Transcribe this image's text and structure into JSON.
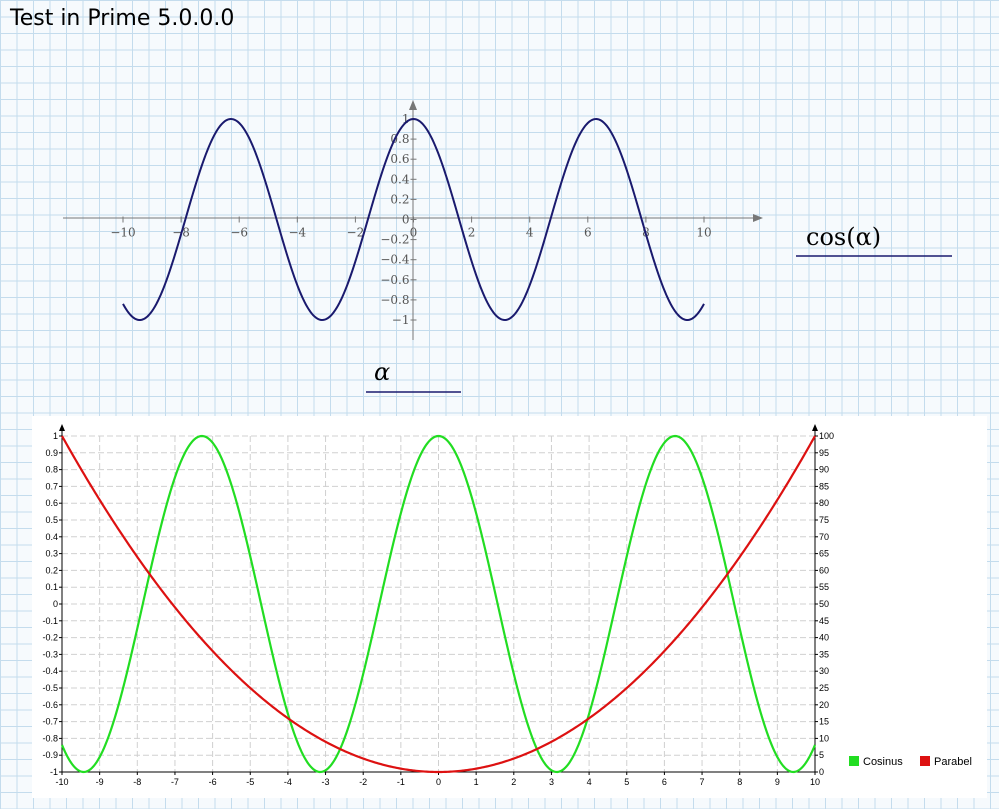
{
  "page": {
    "title": "Test in Prime 5.0.0.0"
  },
  "colors": {
    "cos_top": "#1a1a6e",
    "cosinus": "#22dd22",
    "parabel": "#dd1111",
    "axis": "#777777"
  },
  "chart_data": [
    {
      "type": "line",
      "function": "cos(α)",
      "ylabel": "cos(α)",
      "xlabel": "α",
      "xlim": [
        -10,
        10
      ],
      "ylim": [
        -1,
        1
      ],
      "x_ticks": [
        "−10",
        "−8",
        "−6",
        "−4",
        "−2",
        "0",
        "2",
        "4",
        "6",
        "8",
        "10"
      ],
      "y_ticks": [
        "1",
        "0.8",
        "0.6",
        "0.4",
        "0.2",
        "0",
        "−0.2",
        "−0.4",
        "−0.6",
        "−0.8",
        "−1"
      ],
      "x_tick_values": [
        -10,
        -8,
        -6,
        -4,
        -2,
        0,
        2,
        4,
        6,
        8,
        10
      ],
      "y_tick_values": [
        1,
        0.8,
        0.6,
        0.4,
        0.2,
        0,
        -0.2,
        -0.4,
        -0.6,
        -0.8,
        -1
      ],
      "grid": false
    },
    {
      "type": "line",
      "xlim": [
        -10,
        10
      ],
      "ylim_left": [
        -1,
        1
      ],
      "ylim_right": [
        0,
        100
      ],
      "grid": true,
      "legend_position": "bottom-right",
      "x_ticks": [
        "-10",
        "-9",
        "-8",
        "-7",
        "-6",
        "-5",
        "-4",
        "-3",
        "-2",
        "-1",
        "0",
        "1",
        "2",
        "3",
        "4",
        "5",
        "6",
        "7",
        "8",
        "9",
        "10"
      ],
      "y_left_ticks": [
        "1",
        "0.9",
        "0.8",
        "0.7",
        "0.6",
        "0.5",
        "0.4",
        "0.3",
        "0.2",
        "0.1",
        "0",
        "-0.1",
        "-0.2",
        "-0.3",
        "-0.4",
        "-0.5",
        "-0.6",
        "-0.7",
        "-0.8",
        "-0.9",
        "-1"
      ],
      "y_right_ticks": [
        "100",
        "95",
        "90",
        "85",
        "80",
        "75",
        "70",
        "65",
        "60",
        "55",
        "50",
        "45",
        "40",
        "35",
        "30",
        "25",
        "20",
        "15",
        "10",
        "5",
        "0"
      ],
      "series": [
        {
          "name": "Cosinus",
          "function": "cos(x)",
          "axis": "left"
        },
        {
          "name": "Parabel",
          "function": "x^2",
          "axis": "right"
        }
      ]
    }
  ]
}
